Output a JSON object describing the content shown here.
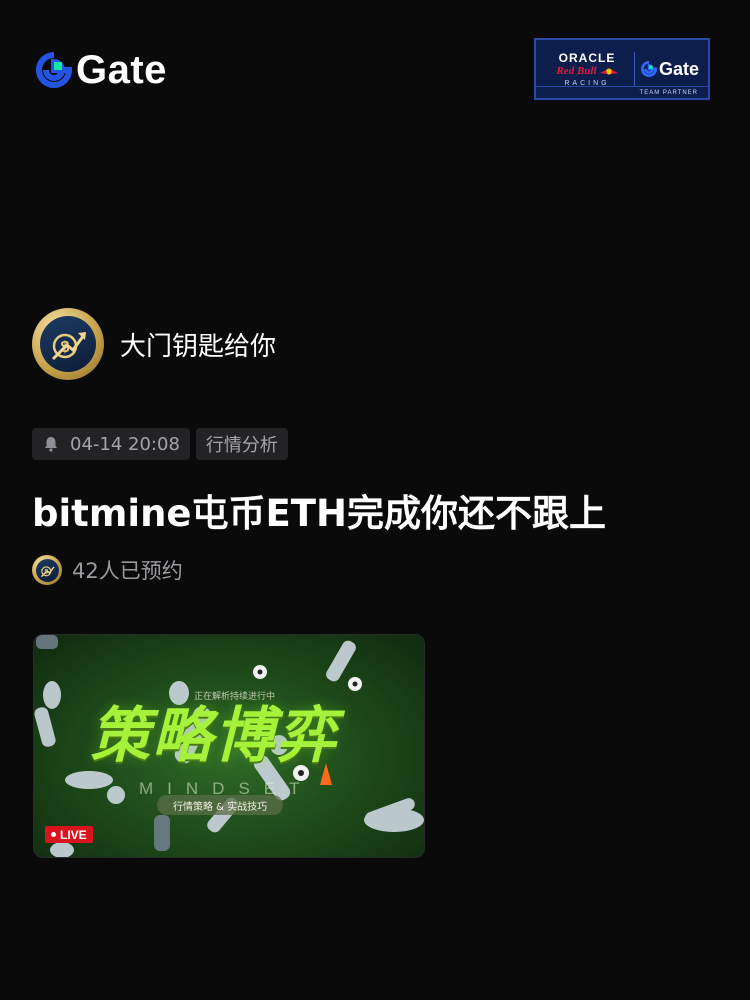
{
  "header": {
    "brand_name": "Gate",
    "partner": {
      "oracle": "ORACLE",
      "redbull": "Red Bull",
      "racing": "RACING",
      "gate": "Gate",
      "footer": "TEAM PARTNER"
    }
  },
  "author": {
    "name": "大门钥匙给你",
    "avatar_icon": "dollar-growth-icon"
  },
  "meta": {
    "time": "04-14 20:08",
    "category": "行情分析",
    "time_icon": "bell-icon"
  },
  "post": {
    "title": "bitmine屯币ETH完成你还不跟上",
    "reservations": "42人已预约"
  },
  "thumbnail": {
    "eyebrow": "正在解析持续进行中",
    "title": "策略博弈",
    "subtitle": "MINDSET",
    "pill": "行情策略 & 实战技巧",
    "live": "LIVE"
  },
  "colors": {
    "background": "#0a0a0b",
    "brand_blue": "#2354e6",
    "brand_green": "#17e6a1",
    "chip_bg": "#232326",
    "live_red": "#d8141e",
    "thumb_green": "#a6f23a"
  }
}
